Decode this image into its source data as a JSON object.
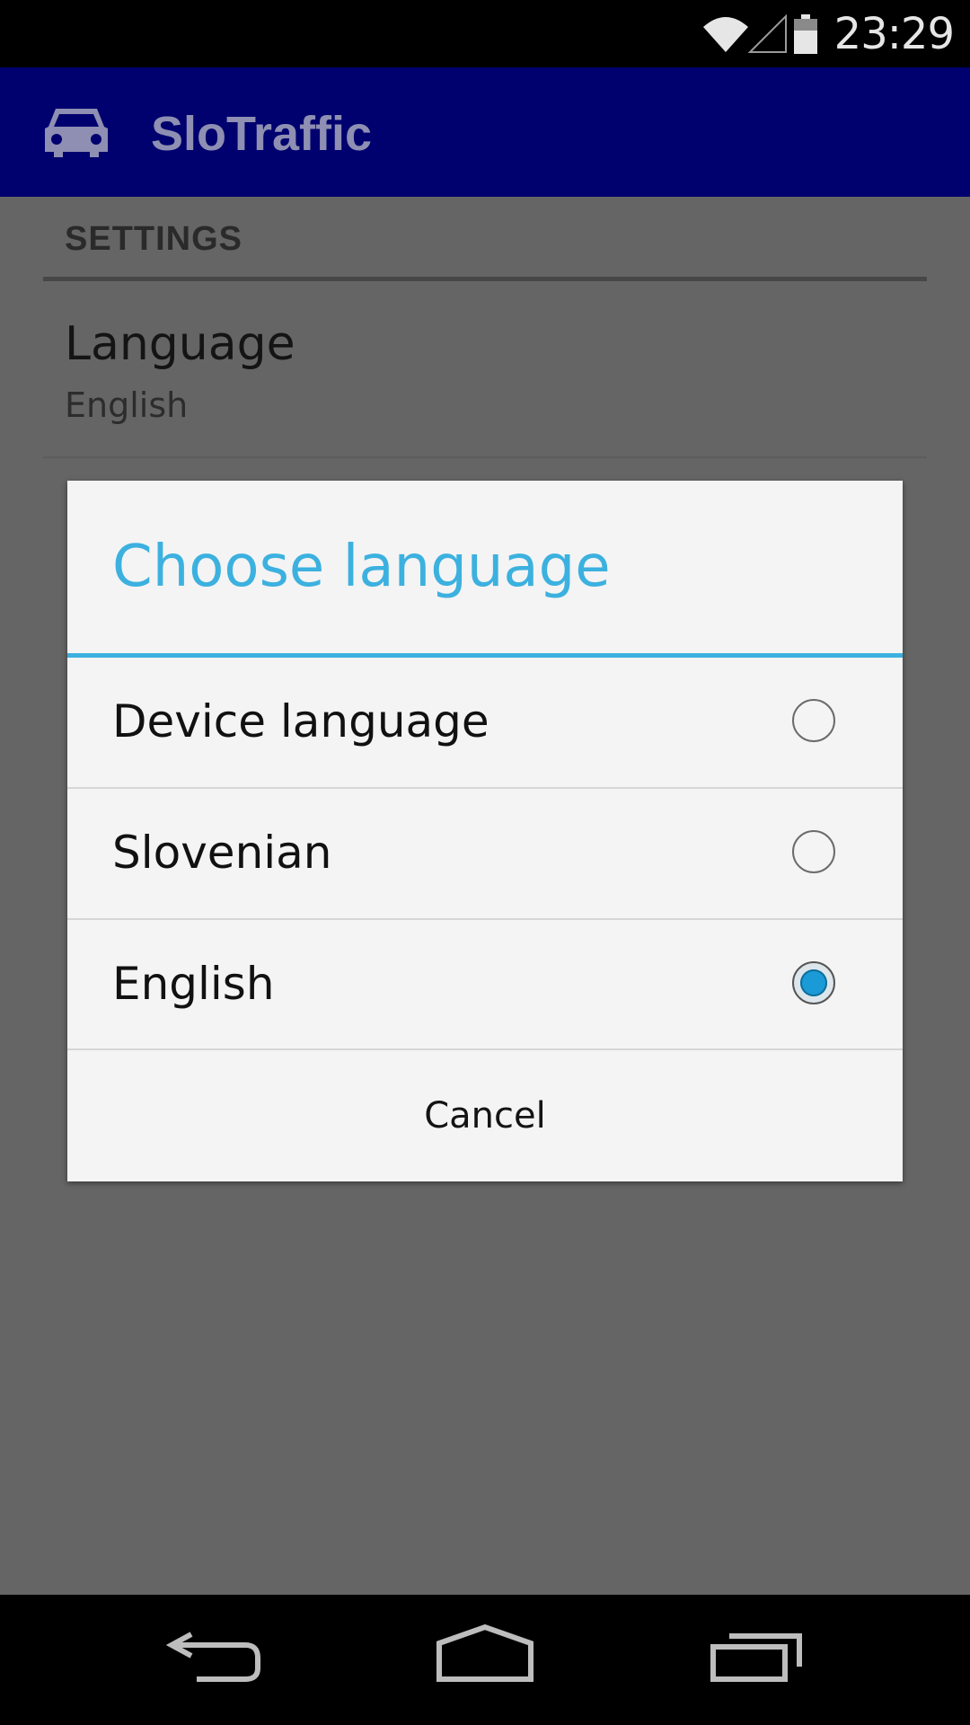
{
  "status_bar": {
    "time": "23:29",
    "icons": [
      "wifi-icon",
      "cell-signal-icon",
      "battery-icon"
    ]
  },
  "action_bar": {
    "title": "SloTraffic",
    "icon": "car-icon",
    "background": "#00006f"
  },
  "settings": {
    "section_header": "SETTINGS",
    "preference": {
      "title": "Language",
      "summary": "English"
    }
  },
  "dialog": {
    "title": "Choose language",
    "accent_color": "#3cb1df",
    "options": [
      {
        "label": "Device language",
        "selected": false
      },
      {
        "label": "Slovenian",
        "selected": false
      },
      {
        "label": "English",
        "selected": true
      }
    ],
    "cancel_label": "Cancel"
  },
  "nav_bar": {
    "icons": [
      "back-icon",
      "home-icon",
      "recent-apps-icon"
    ]
  }
}
